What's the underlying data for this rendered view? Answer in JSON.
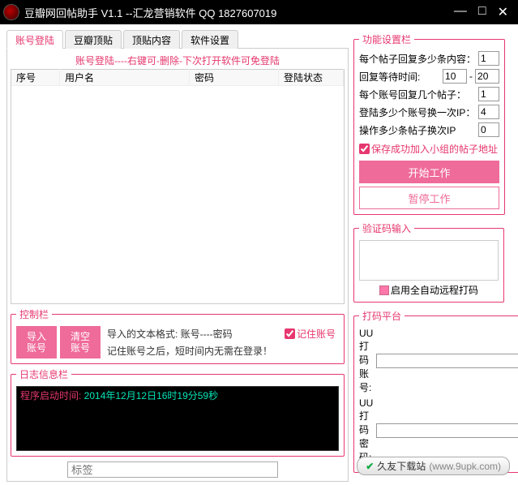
{
  "titlebar": {
    "title": "豆瓣网回帖助手 V1.1 --汇龙营销软件  QQ 1827607019"
  },
  "tabs": [
    "账号登陆",
    "豆瓣顶贴",
    "顶贴内容",
    "软件设置"
  ],
  "hint": "账号登陆----右键可-删除-下次打开软件可免登陆",
  "table_headers": [
    "序号",
    "用户名",
    "密码",
    "登陆状态"
  ],
  "control": {
    "legend": "控制栏",
    "import_btn": "导入\n账号",
    "clear_btn": "清空\n账号",
    "line1": "导入的文本格式: 账号----密码",
    "line2": "记住账号之后，短时间内无需在登录！",
    "remember": "记住账号"
  },
  "log": {
    "legend": "日志信息栏",
    "prefix": "程序启动时间: ",
    "time": "2014年12月12日16时19分59秒"
  },
  "tag": {
    "placeholder": "标签"
  },
  "settings": {
    "legend": "功能设置栏",
    "row1": "每个帖子回复多少条内容：",
    "val1": "1",
    "row2": "回复等待时间:",
    "val2a": "10",
    "val2b": "20",
    "row3": "每个账号回复几个帖子：",
    "val3": "1",
    "row4": "登陆多少个账号换一次IP：",
    "val4": "4",
    "row5": "操作多少条帖子换次IP",
    "val5": "0",
    "save_chk": "保存成功加入小组的帖子地址",
    "start_btn": "开始工作",
    "pause_btn": "暂停工作"
  },
  "captcha": {
    "legend": "验证码输入",
    "auto_chk": "启用全自动远程打码"
  },
  "coding": {
    "legend": "打码平台",
    "user": "UU打码账号:",
    "pass": "UU打码密码:"
  },
  "footer": {
    "text": "久友下载站",
    "url": "(www.9upk.com)"
  }
}
